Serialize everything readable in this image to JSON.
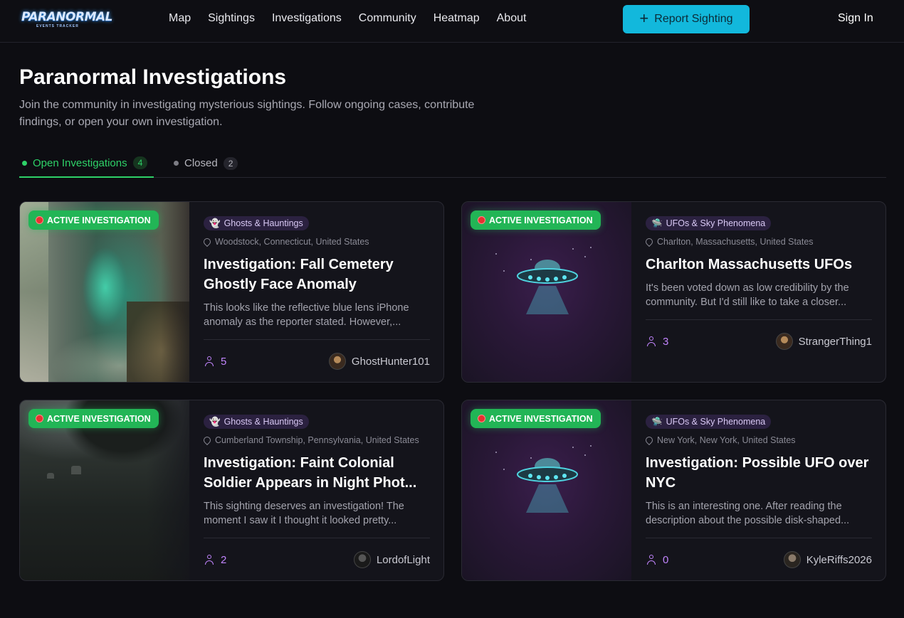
{
  "brand": {
    "logo_text": "PARANORMAL",
    "logo_subtext": "EVENTS TRACKER"
  },
  "nav": [
    "Map",
    "Sightings",
    "Investigations",
    "Community",
    "Heatmap",
    "About"
  ],
  "header": {
    "report_label": "Report Sighting",
    "signin_label": "Sign In"
  },
  "page": {
    "title": "Paranormal Investigations",
    "description": "Join the community in investigating mysterious sightings. Follow ongoing cases, contribute findings, or open your own investigation."
  },
  "tabs": {
    "open": {
      "label": "Open Investigations",
      "count": "4"
    },
    "closed": {
      "label": "Closed",
      "count": "2"
    }
  },
  "status_label": "ACTIVE INVESTIGATION",
  "cards": [
    {
      "category": "Ghosts & Hauntings",
      "category_icon": "👻",
      "location": "Woodstock, Connecticut, United States",
      "title": "Investigation: Fall Cemetery Ghostly Face Anomaly",
      "description": "This looks like the reflective blue lens iPhone anomaly as the reporter stated. However,...",
      "members": "5",
      "author": "GhostHunter101"
    },
    {
      "category": "UFOs & Sky Phenomena",
      "category_icon": "🛸",
      "location": "Charlton, Massachusetts, United States",
      "title": "Charlton Massachusetts UFOs",
      "description": "It's been voted down as low credibility by the community. But I'd still like to take a closer...",
      "members": "3",
      "author": "StrangerThing1"
    },
    {
      "category": "Ghosts & Hauntings",
      "category_icon": "👻",
      "location": "Cumberland Township, Pennsylvania, United States",
      "title": "Investigation: Faint Colonial Soldier Appears in Night Phot...",
      "description": "This sighting deserves an investigation! The moment I saw it I thought it looked pretty...",
      "members": "2",
      "author": "LordofLight"
    },
    {
      "category": "UFOs & Sky Phenomena",
      "category_icon": "🛸",
      "location": "New York, New York, United States",
      "title": "Investigation: Possible UFO over NYC",
      "description": "This is an interesting one. After reading the description about the possible disk-shaped...",
      "members": "0",
      "author": "KyleRiffs2026"
    }
  ],
  "colors": {
    "accent_green": "#2ed168",
    "accent_cyan": "#12b8dc",
    "accent_purple": "#c084fc",
    "background": "#0d0d12"
  }
}
